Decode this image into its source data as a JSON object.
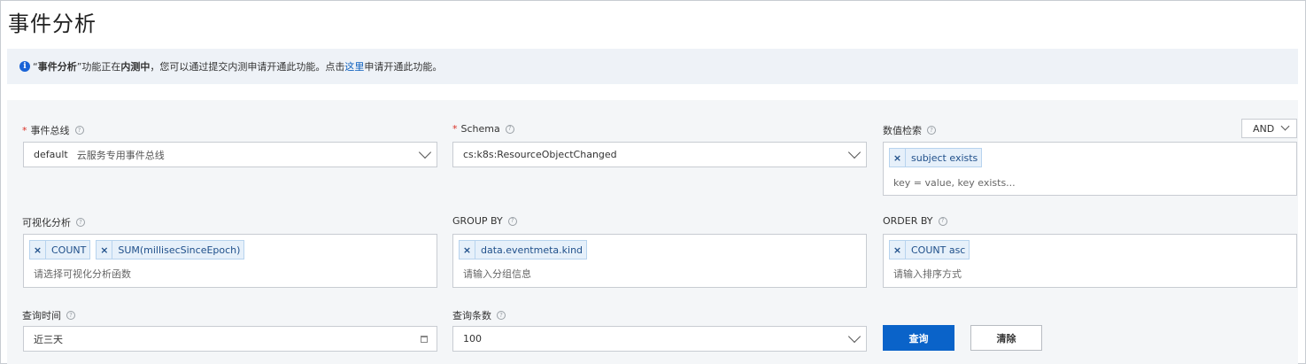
{
  "page": {
    "title": "事件分析"
  },
  "notice": {
    "quote_open": "“",
    "feature_name": "事件分析",
    "quote_close": "”",
    "text1": "功能正在",
    "status": "内测中",
    "text2": "，您可以通过提交内测申请开通此功能。点击",
    "link": "这里",
    "text3": "申请开通此功能。"
  },
  "form": {
    "event_bus": {
      "label": "事件总线",
      "value": "default",
      "value_desc": "云服务专用事件总线"
    },
    "schema": {
      "label": "Schema",
      "value": "cs:k8s:ResourceObjectChanged"
    },
    "value_search": {
      "label": "数值检索",
      "operator": "AND",
      "tags": [
        "subject exists"
      ],
      "placeholder": "key = value, key exists..."
    },
    "visualization": {
      "label": "可视化分析",
      "tags": [
        "COUNT",
        "SUM(millisecSinceEpoch)"
      ],
      "placeholder": "请选择可视化分析函数"
    },
    "group_by": {
      "label": "GROUP BY",
      "tags": [
        "data.eventmeta.kind"
      ],
      "placeholder": "请输入分组信息"
    },
    "order_by": {
      "label": "ORDER BY",
      "tags": [
        "COUNT asc"
      ],
      "placeholder": "请输入排序方式"
    },
    "query_time": {
      "label": "查询时间",
      "value": "近三天"
    },
    "query_count": {
      "label": "查询条数",
      "value": "100"
    }
  },
  "buttons": {
    "query": "查询",
    "clear": "清除"
  },
  "icons": {
    "help": "?",
    "info": "i",
    "remove": "×"
  },
  "colors": {
    "primary": "#0a63c9",
    "link": "#0b5fbe",
    "required": "#d93026"
  }
}
